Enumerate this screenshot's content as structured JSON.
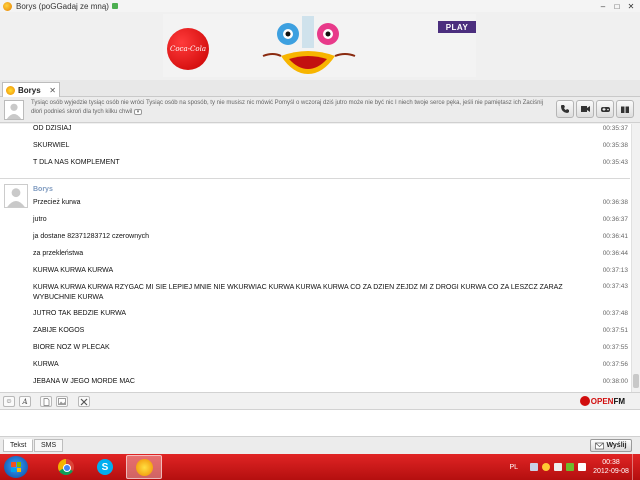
{
  "window": {
    "title": "Borys (poGGadaj ze mną)",
    "controls": [
      "–",
      "□",
      "✕"
    ]
  },
  "ad": {
    "cola_label": "Coca-Cola",
    "play_label": "PLAY"
  },
  "tab": {
    "label": "Borys",
    "close": "✕"
  },
  "contact": {
    "status": "Tysiąc osób wyjedzie tysiąc osób nie wróci Tysiąc osób na sposób, ty nie musisz nic mówić Pomyśl o wczoraj dziś jutro może nie być nic I niech twoje serce pęka, jeśli nie pamiętasz ich Zaciśnij dłoń podnieś skroń dla tych kilku chwil",
    "more": "▾"
  },
  "messages_top": [
    {
      "text": "OD DZISIAJ",
      "time": "00:35:37"
    },
    {
      "text": "SKURWIEL",
      "time": "00:35:38"
    },
    {
      "text": "T DLA NAS KOMPLEMENT",
      "time": "00:35:43"
    }
  ],
  "sender": "Borys",
  "messages": [
    {
      "text": "Przecież kurwa",
      "time": "00:36:38"
    },
    {
      "text": "jutro",
      "time": "00:36:37"
    },
    {
      "text": "ja dostane 82371283712 czerownych",
      "time": "00:36:41"
    },
    {
      "text": "za przekleństwa",
      "time": "00:36:44"
    },
    {
      "text": "KURWA KURWA KURWA",
      "time": "00:37:13"
    },
    {
      "text": "KURWA KURWA KURWA RZYGAC MI SIE LEPIEJ MNIE NIE WKURWIAC KURWA KURWA KURWA CO ZA DZIEN ZEJDZ MI Z DROGI KURWA CO ZA LESZCZ ZARAZ WYBUCHNIE KURWA",
      "time": "00:37:43"
    },
    {
      "text": "JUTRO TAK BEDZIE KURWA",
      "time": "00:37:48"
    },
    {
      "text": "ZABIJE KOGOS",
      "time": "00:37:51"
    },
    {
      "text": "BIORE NOZ W PLECAK",
      "time": "00:37:55"
    },
    {
      "text": "KURWA",
      "time": "00:37:56"
    },
    {
      "text": "JEBANA W JEGO MORDE MAC",
      "time": "00:38:00"
    }
  ],
  "toolbar": {
    "emoticon": "☺",
    "font": "A",
    "openfm_open": "OPEN",
    "openfm_fm": "FM"
  },
  "bottom": {
    "tab_text": "Tekst",
    "tab_sms": "SMS",
    "send": "Wyślij"
  },
  "taskbar": {
    "lang": "PL",
    "time": "00:38",
    "date": "2012-09-08"
  }
}
